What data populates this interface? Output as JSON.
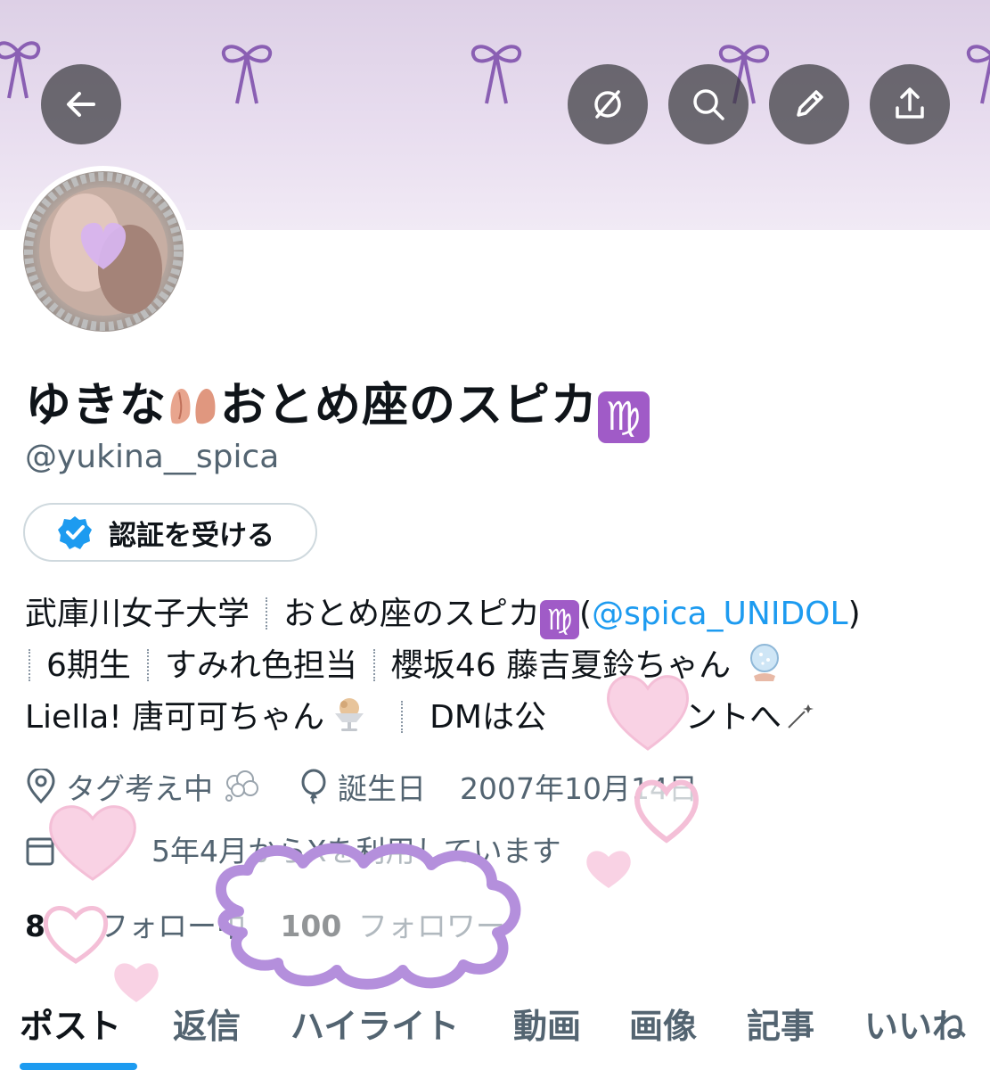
{
  "header": {
    "back_icon": "arrow-left-icon",
    "actions": [
      {
        "name": "hide-icon"
      },
      {
        "name": "search-icon"
      },
      {
        "name": "edit-icon"
      },
      {
        "name": "share-icon"
      }
    ]
  },
  "profile": {
    "name_part1": "ゆきな",
    "name_part2": "おとめ座のスピカ",
    "virgo_symbol": "♍",
    "handle": "@yukina__spica",
    "verify_label": "認証を受ける",
    "bio": {
      "line1_a": "武庫川女子大学",
      "line1_b": "おとめ座のスピカ",
      "line1_paren_open": "(",
      "line1_link": "@spica_UNIDOL",
      "line1_paren_close": ")",
      "line2_a": "6期生",
      "line2_b": "すみれ色担当",
      "line2_c": "櫻坂46 藤吉夏鈴ちゃん",
      "line3_a": "Liella! 唐可可ちゃん",
      "line3_b": "DMは公",
      "line3_c": "ウントへ"
    },
    "location": "タグ考え中",
    "birthday_label": "誕生日",
    "birthday_value": "2007年10月14日",
    "joined_a": "",
    "joined_b": "5年4月からXを利用しています",
    "following_count": "8",
    "following_label": "フォロー中",
    "followers_count": "100",
    "followers_label": "フォロワー"
  },
  "tabs": [
    "ポスト",
    "返信",
    "ハイライト",
    "動画",
    "画像",
    "記事",
    "いいね"
  ],
  "colors": {
    "accent": "#1d9bf0",
    "banner": "#e6dcee",
    "ribbon": "#8a5fb3",
    "virgo": "#a05bc7",
    "sticker_heart": "#f6c6dc",
    "sticker_cloud": "#b48fdc"
  }
}
